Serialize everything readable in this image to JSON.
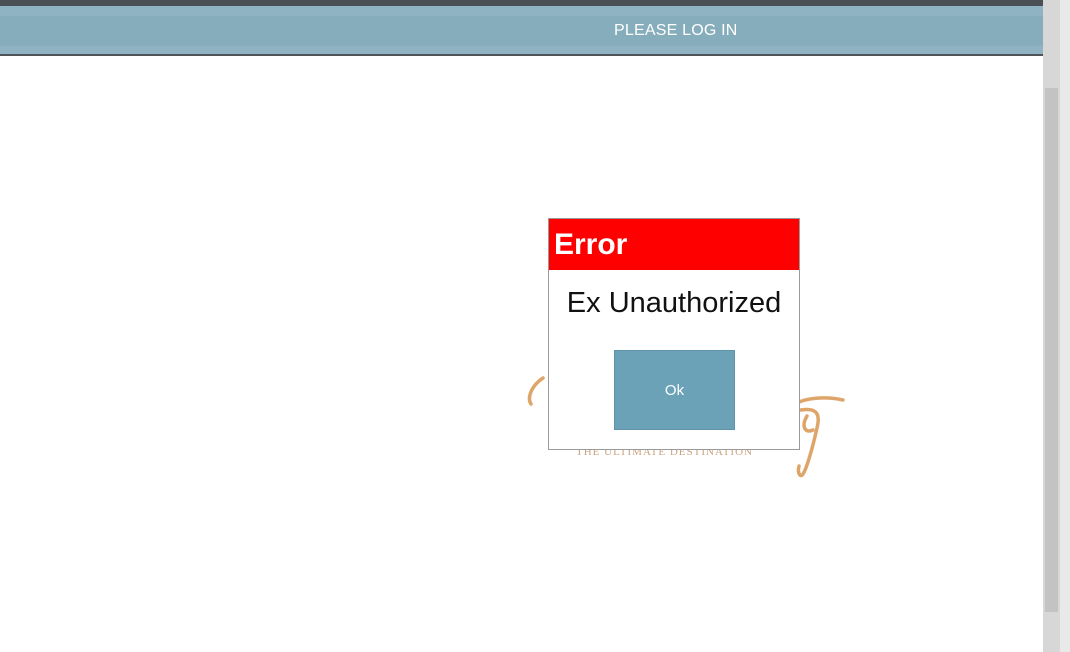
{
  "header": {
    "title": "PLEASE LOG IN"
  },
  "logo": {
    "tagline": "THE ULTIMATE DESTINATION"
  },
  "dialog": {
    "title": "Error",
    "message": "Ex Unauthorized",
    "ok_label": "Ok",
    "title_color": "#ff0000",
    "button_color": "#6ba2b8"
  }
}
